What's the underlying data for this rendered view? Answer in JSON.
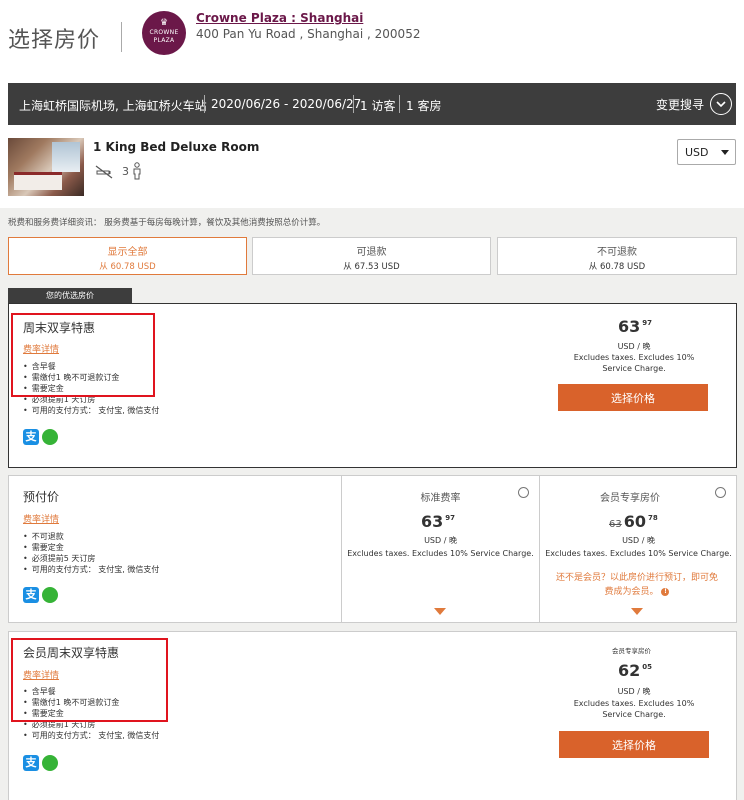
{
  "page": {
    "title": "选择房价"
  },
  "hotel": {
    "logo_text_1": "CROWNE",
    "logo_text_2": "PLAZA",
    "name": "Crowne Plaza : Shanghai",
    "address": "400 Pan Yu Road , Shanghai , 200052"
  },
  "search": {
    "location": "上海虹桥国际机场, 上海虹桥火车站",
    "dates": "2020/06/26 - 2020/06/27",
    "guests": "1 访客",
    "rooms": "1 客房",
    "modify_label": "变更搜寻"
  },
  "room": {
    "title": "1 King Bed Deluxe Room",
    "guest_count": "3",
    "currency": "USD"
  },
  "tax_note": "税费和服务费详细资讯： 服务费基于每房每晚计算，餐饮及其他消费按照总价计算。",
  "filters": [
    {
      "label": "显示全部",
      "sub": "从 60.78 USD",
      "active": true
    },
    {
      "label": "可退款",
      "sub": "从 67.53 USD",
      "active": false
    },
    {
      "label": "不可退款",
      "sub": "从 60.78 USD",
      "active": false
    }
  ],
  "preferred_label": "您的优选房价",
  "rates": [
    {
      "name": "周末双享特惠",
      "details_link": "费率详情",
      "bullets": [
        "含早餐",
        "需缴付1 晚不可退款订金",
        "需要定金",
        "必须提前1 天订房",
        "可用的支付方式： 支付宝, 微信支付"
      ],
      "price_int": "63",
      "price_dec": "97",
      "unit": "USD / 晚",
      "tax_text": "Excludes taxes. Excludes 10% Service Charge.",
      "button": "选择价格"
    },
    {
      "name": "预付价",
      "details_link": "费率详情",
      "bullets": [
        "不可退款",
        "需要定金",
        "必须提前5 天订房",
        "可用的支付方式： 支付宝, 微信支付"
      ],
      "options": [
        {
          "head": "标准费率",
          "price_int": "63",
          "price_dec": "97",
          "unit": "USD / 晚",
          "tax_text": "Excludes taxes. Excludes 10% Service Charge."
        },
        {
          "head": "会员专享房价",
          "old_price": "63",
          "price_int": "60",
          "price_dec": "78",
          "unit": "USD / 晚",
          "tax_text": "Excludes taxes. Excludes 10% Service Charge.",
          "note": "还不是会员？以此房价进行预订，即可免费成为会员。"
        }
      ]
    },
    {
      "name": "会员周末双享特惠",
      "details_link": "费率详情",
      "bullets": [
        "含早餐",
        "需缴付1 晚不可退款订金",
        "需要定金",
        "必须提前1 天订房",
        "可用的支付方式： 支付宝, 微信支付"
      ],
      "member_label": "会员专享房价",
      "price_int": "62",
      "price_dec": "05",
      "unit": "USD / 晚",
      "tax_text": "Excludes taxes. Excludes 10% Service Charge.",
      "button": "选择价格"
    }
  ],
  "colors": {
    "accent": "#e07a3c",
    "button": "#d9622b",
    "brand": "#6b1849",
    "highlight": "#e0141e"
  }
}
